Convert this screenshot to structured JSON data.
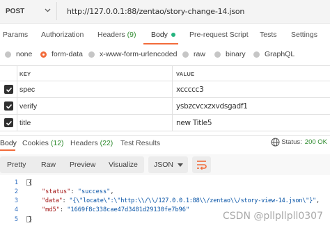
{
  "request": {
    "method": "POST",
    "url": "http://127.0.0.1:88/zentao/story-change-14.json"
  },
  "req_tabs": [
    {
      "label": "Params"
    },
    {
      "label": "Authorization"
    },
    {
      "label": "Headers",
      "count": "(9)"
    },
    {
      "label": "Body"
    },
    {
      "label": "Pre-request Script"
    },
    {
      "label": "Tests"
    },
    {
      "label": "Settings"
    }
  ],
  "body_types": [
    {
      "label": "none",
      "selected": false
    },
    {
      "label": "form-data",
      "selected": true
    },
    {
      "label": "x-www-form-urlencoded",
      "selected": false
    },
    {
      "label": "raw",
      "selected": false
    },
    {
      "label": "binary",
      "selected": false
    },
    {
      "label": "GraphQL",
      "selected": false
    }
  ],
  "table": {
    "key_header": "KEY",
    "value_header": "VALUE",
    "rows": [
      {
        "key": "spec",
        "value": "xccccc3",
        "checked": true
      },
      {
        "key": "verify",
        "value": "ysbzcvcxzxvdsgadf1",
        "checked": true
      },
      {
        "key": "title",
        "value": "new Title5",
        "checked": true
      }
    ]
  },
  "resp_tabs": [
    {
      "label": "Body"
    },
    {
      "label": "Cookies",
      "count": "(12)"
    },
    {
      "label": "Headers",
      "count": "(22)"
    },
    {
      "label": "Test Results"
    }
  ],
  "status": {
    "label": "Status:",
    "value": "200 OK"
  },
  "view_modes": [
    "Pretty",
    "Raw",
    "Preview",
    "Visualize"
  ],
  "format": "JSON",
  "code_lines": [
    {
      "n": "1",
      "text": "{"
    },
    {
      "n": "2",
      "key": "\"status\"",
      "sep": ": ",
      "val": "\"success\"",
      "tail": ","
    },
    {
      "n": "3",
      "key": "\"data\"",
      "sep": ": ",
      "val": "\"{\\\"locate\\\":\\\"http:\\\\/\\\\/127.0.0.1:88\\\\/zentao\\\\/story-view-14.json\\\"}\"",
      "tail": ","
    },
    {
      "n": "4",
      "key": "\"md5\"",
      "sep": ": ",
      "val": "\"1669f8c338cae47d3481d29130fe7b96\"",
      "tail": ""
    },
    {
      "n": "5",
      "text": "}"
    }
  ],
  "watermark": "CSDN @pllpllpll0307",
  "colors": {
    "accent": "#f26b3a",
    "success": "#26b47f",
    "count": "#2e8b2e"
  }
}
